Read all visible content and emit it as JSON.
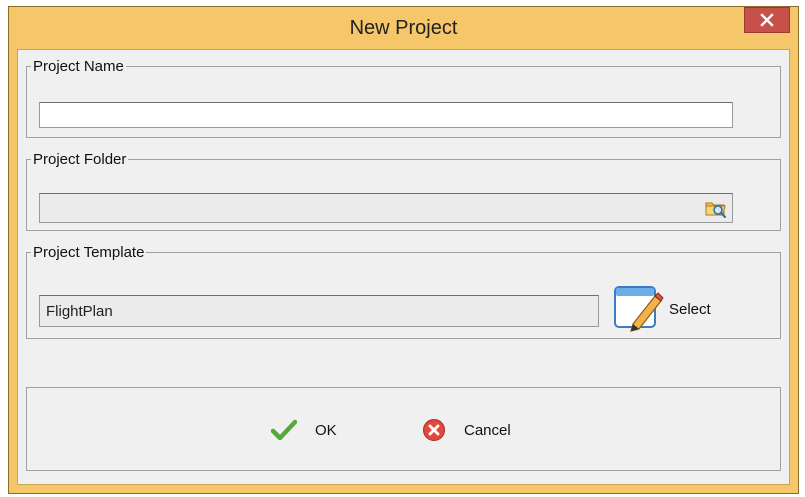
{
  "window": {
    "title": "New Project",
    "accent_color": "#f5c76a",
    "close_color": "#c7514a"
  },
  "project_name": {
    "legend": "Project Name",
    "value": ""
  },
  "project_folder": {
    "legend": "Project Folder",
    "value": "",
    "browse_icon": "folder-search-icon"
  },
  "project_template": {
    "legend": "Project Template",
    "value": "FlightPlan",
    "select_label": "Select",
    "select_icon": "edit-window-icon"
  },
  "actions": {
    "ok_label": "OK",
    "cancel_label": "Cancel"
  }
}
